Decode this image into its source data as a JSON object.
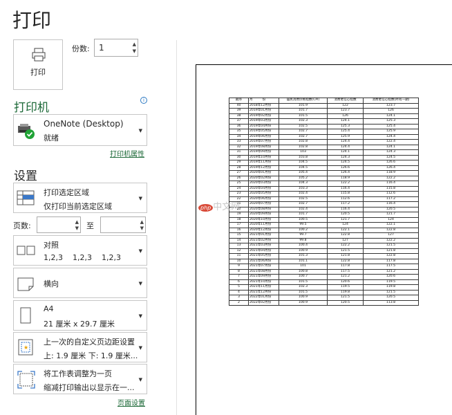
{
  "title": "打印",
  "print_button": {
    "label": "打印"
  },
  "copies": {
    "label": "份数:",
    "value": "1"
  },
  "printer": {
    "heading": "打印机",
    "name": "OneNote (Desktop)",
    "status": "就绪",
    "properties_link": "打印机属性"
  },
  "settings": {
    "heading": "设置",
    "print_area": {
      "line1": "打印选定区域",
      "line2": "仅打印当前选定区域"
    },
    "pages": {
      "label": "页数:",
      "to": "至"
    },
    "collate": {
      "line1": "对照",
      "line2": "1,2,3    1,2,3    1,2,3"
    },
    "orientation": {
      "line1": "横向"
    },
    "paper": {
      "line1": "A4",
      "line2": "21 厘米 x 29.7 厘米"
    },
    "margins": {
      "line1": "上一次的自定义页边距设置",
      "line2": "上: 1.9 厘米 下: 1.9 厘米..."
    },
    "scaling": {
      "line1": "将工作表调整为一页",
      "line2": "缩减打印输出以显示在一..."
    },
    "page_setup_link": "页面设置"
  },
  "watermark": {
    "badge": "php",
    "text": "中文网"
  },
  "sheet": {
    "headers": [
      "期序",
      "月",
      "份",
      "居民消费价格指数(CPI)",
      "消费者信心指数",
      "消费者信心指数(所有一期)"
    ],
    "rows": [
      [
        "40",
        "2018年12月份",
        "101.9",
        "122",
        "123.7"
      ],
      [
        "39",
        "2019年01月份",
        "101.7",
        "123.7",
        "126"
      ],
      [
        "38",
        "2019年02月份",
        "101.5",
        "126",
        "124.1"
      ],
      [
        "37",
        "2019年03月份",
        "102.3",
        "124.1",
        "125.3"
      ],
      [
        "36",
        "2019年04月份",
        "102.5",
        "125.3",
        "125.4"
      ],
      [
        "35",
        "2019年05月份",
        "102.7",
        "125.4",
        "125.9"
      ],
      [
        "34",
        "2019年06月份",
        "102.7",
        "125.9",
        "124.4"
      ],
      [
        "33",
        "2019年07月份",
        "102.8",
        "124.4",
        "122.4"
      ],
      [
        "32",
        "2019年08月份",
        "102.8",
        "124.4",
        "124.1"
      ],
      [
        "31",
        "2019年09月份",
        "103",
        "124.1",
        "124.3"
      ],
      [
        "30",
        "2019年10月份",
        "103.8",
        "124.3",
        "124.5"
      ],
      [
        "29",
        "2019年11月份",
        "104.5",
        "124.5",
        "126.6"
      ],
      [
        "28",
        "2019年12月份",
        "104.5",
        "126.6",
        "126.4"
      ],
      [
        "27",
        "2020年01月份",
        "105.4",
        "126.4",
        "118.9"
      ],
      [
        "26",
        "2020年02月份",
        "105.2",
        "118.9",
        "122.2"
      ],
      [
        "25",
        "2020年03月份",
        "104.3",
        "122.2",
        "116.4"
      ],
      [
        "24",
        "2020年04月份",
        "103.3",
        "116.4",
        "115.8"
      ],
      [
        "23",
        "2020年05月份",
        "102.4",
        "115.8",
        "112.6"
      ],
      [
        "22",
        "2020年06月份",
        "102.5",
        "112.6",
        "117.2"
      ],
      [
        "21",
        "2020年07月份",
        "102.7",
        "117.2",
        "116.4"
      ],
      [
        "20",
        "2020年08月份",
        "102.4",
        "116.4",
        "120.5"
      ],
      [
        "19",
        "2020年09月份",
        "101.7",
        "120.5",
        "121.7"
      ],
      [
        "18",
        "2020年10月份",
        "100.5",
        "121.7",
        "124"
      ],
      [
        "17",
        "2020年11月份",
        "99.5",
        "124",
        "122.1"
      ],
      [
        "16",
        "2020年12月份",
        "100.2",
        "122.1",
        "122.8"
      ],
      [
        "15",
        "2021年01月份",
        "99.7",
        "122.8",
        "127"
      ],
      [
        "14",
        "2021年02月份",
        "99.8",
        "127",
        "122.2"
      ],
      [
        "13",
        "2021年03月份",
        "100.4",
        "122.2",
        "121.5"
      ],
      [
        "12",
        "2021年04月份",
        "100.9",
        "121.5",
        "121.8"
      ],
      [
        "11",
        "2021年05月份",
        "101.3",
        "121.8",
        "122.8"
      ],
      [
        "10",
        "2021年06月份",
        "101.1",
        "122.8",
        "117.8"
      ],
      [
        "9",
        "2021年07月份",
        "101",
        "117.8",
        "117.5"
      ],
      [
        "8",
        "2021年08月份",
        "100.8",
        "117.5",
        "121.2"
      ],
      [
        "7",
        "2021年09月份",
        "100.7",
        "121.2",
        "120.6"
      ],
      [
        "6",
        "2021年10月份",
        "101.5",
        "120.6",
        "119.5"
      ],
      [
        "5",
        "2021年11月份",
        "102.3",
        "119.5",
        "119.8"
      ],
      [
        "4",
        "2021年12月份",
        "101.5",
        "119.8",
        "121.5"
      ],
      [
        "3",
        "2022年01月份",
        "100.9",
        "121.5",
        "120.5"
      ],
      [
        "2",
        "2022年02月份",
        "100.9",
        "120.5",
        "113.8"
      ]
    ]
  }
}
